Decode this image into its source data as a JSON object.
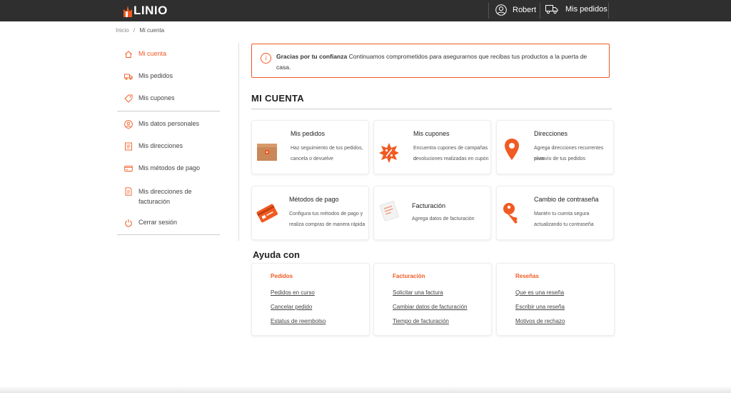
{
  "header": {
    "logo_text": "LINIO",
    "user_name": "Robert",
    "orders_label": "Mis pedidos"
  },
  "breadcrumb": {
    "home": "Inicio",
    "separator": "/",
    "current": "Mi cuenta"
  },
  "sidebar": {
    "items": [
      {
        "label": "Mi cuenta",
        "icon": "home-icon"
      },
      {
        "label": "Mis pedidos",
        "icon": "truck-icon"
      },
      {
        "label": "Mis cupones",
        "icon": "tag-icon"
      },
      {
        "label": "Mis datos personales",
        "icon": "user-icon"
      },
      {
        "label": "Mis direcciones",
        "icon": "address-icon"
      },
      {
        "label": "Mis métodos de pago",
        "icon": "card-icon"
      },
      {
        "label": "Mis direcciones de facturación",
        "icon": "invoice-icon"
      },
      {
        "label": "Cerrar sesión",
        "icon": "power-icon"
      }
    ]
  },
  "notice": {
    "bold": "Gracias por tu confianza",
    "text": " Continuamos comprometidos para asegurarnos que recibas tus productos a la puerta de casa."
  },
  "main": {
    "title": "MI CUENTA",
    "cards": [
      {
        "title": "Mis pedidos",
        "desc1": "Haz seguimiento de tus pedidos,",
        "desc2": "cancela o devuelve",
        "icon": "box-icon"
      },
      {
        "title": "Mis cupones",
        "desc1": "Encuentra cupones de campañas o",
        "desc2": "devoluciones realizadas en cupón",
        "icon": "coupon-icon"
      },
      {
        "title": "Direcciones",
        "desc1": "Agrega direcciones recurrentes para",
        "desc2": "el envío de tus pedidos",
        "icon": "location-pin-icon"
      },
      {
        "title": "Métodos de pago",
        "desc1": "Configura tus métodos de pago y",
        "desc2": "realiza compras de manera rápida",
        "icon": "credit-card-icon"
      },
      {
        "title": "Facturación",
        "desc1": "Agrega datos de facturación",
        "desc2": "",
        "icon": "receipt-icon"
      },
      {
        "title": "Cambio de contraseña",
        "desc1": "Mantén tu cuenta segura",
        "desc2": "actualizando tu contraseña",
        "icon": "key-icon"
      }
    ]
  },
  "help": {
    "title": "Ayuda con",
    "columns": [
      {
        "heading": "Pedidos",
        "links": [
          "Pedidos en curso",
          "Cancelar pedido",
          "Estatus de reembolso"
        ]
      },
      {
        "heading": "Facturación",
        "links": [
          "Solicitar una factura",
          "Cambiar datos de facturación",
          "Tiempo de facturación"
        ]
      },
      {
        "heading": "Reseñas",
        "links": [
          "Que es una reseña",
          "Escribir una reseña",
          "Motivos de rechazo"
        ]
      }
    ]
  },
  "colors": {
    "accent": "#f15a22",
    "topbar": "#2f2f2f"
  }
}
